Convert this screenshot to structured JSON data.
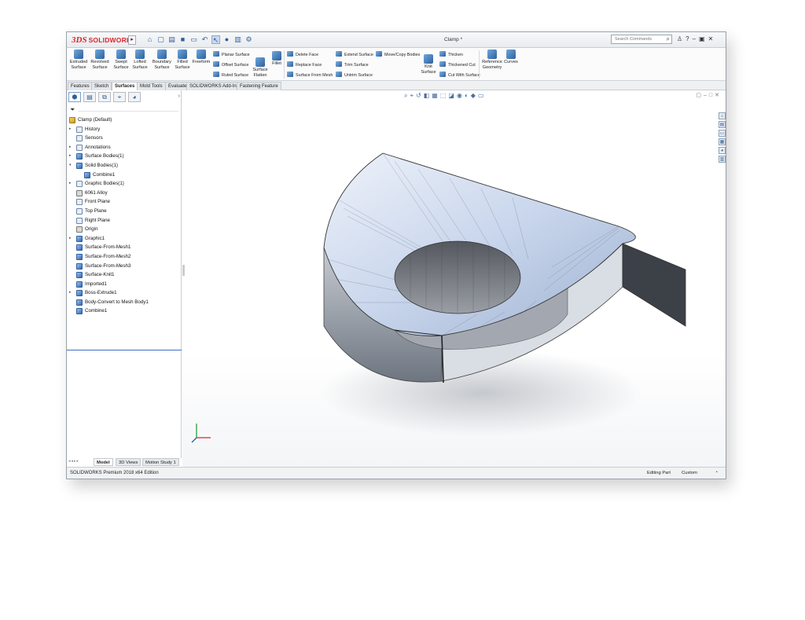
{
  "app": {
    "brand_mark": "3DS",
    "brand_name": "SOLIDWORKS",
    "doc_title": "Clamp *"
  },
  "search": {
    "placeholder": "Search Commands"
  },
  "ribbon": {
    "large_buttons": [
      {
        "label": "Extruded\nSurface",
        "icon": "extruded-surface-icon"
      },
      {
        "label": "Revolved\nSurface",
        "icon": "revolved-surface-icon"
      },
      {
        "label": "Swept\nSurface",
        "icon": "swept-surface-icon"
      },
      {
        "label": "Lofted\nSurface",
        "icon": "lofted-surface-icon"
      },
      {
        "label": "Boundary\nSurface",
        "icon": "boundary-surface-icon"
      },
      {
        "label": "Filled\nSurface",
        "icon": "filled-surface-icon"
      },
      {
        "label": "Freeform",
        "icon": "freeform-icon"
      }
    ],
    "col1": [
      "Planar Surface",
      "Offset Surface",
      "Ruled Surface"
    ],
    "surface_flatten": "Surface\nFlatten",
    "fillet": "Fillet",
    "col2": [
      "Delete Face",
      "Replace Face",
      "Surface From Mesh"
    ],
    "col3": [
      "Extend Surface",
      "Trim Surface",
      "Untrim Surface"
    ],
    "move_copy": "Move/Copy Bodies",
    "knit": "Knit\nSurface",
    "col4": [
      "Thicken",
      "Thickened Cut",
      "Cut With Surface"
    ],
    "reference_geometry": "Reference\nGeometry",
    "curves": "Curves"
  },
  "tabs": [
    "Features",
    "Sketch",
    "Surfaces",
    "Mold Tools",
    "Evaluate",
    "SOLIDWORKS Add-Ins",
    "Fastening Feature"
  ],
  "active_tab": "Surfaces",
  "tree": {
    "root": "Clamp  (Default)",
    "items": [
      {
        "label": "History",
        "expandable": true,
        "indent": 1,
        "icon": "history-icon"
      },
      {
        "label": "Sensors",
        "expandable": false,
        "indent": 1,
        "icon": "sensors-icon"
      },
      {
        "label": "Annotations",
        "expandable": true,
        "indent": 1,
        "icon": "annotations-icon"
      },
      {
        "label": "Surface Bodies(1)",
        "expandable": true,
        "indent": 1,
        "icon": "surface-bodies-icon"
      },
      {
        "label": "Solid Bodies(1)",
        "expandable": true,
        "expanded": true,
        "indent": 1,
        "icon": "solid-bodies-icon"
      },
      {
        "label": "Combine1",
        "expandable": false,
        "indent": 2,
        "icon": "combine-icon"
      },
      {
        "label": "Graphic Bodies(1)",
        "expandable": true,
        "indent": 1,
        "icon": "graphic-bodies-icon"
      },
      {
        "label": "6061 Alloy",
        "expandable": false,
        "indent": 1,
        "icon": "material-icon"
      },
      {
        "label": "Front Plane",
        "expandable": false,
        "indent": 1,
        "icon": "plane-icon"
      },
      {
        "label": "Top Plane",
        "expandable": false,
        "indent": 1,
        "icon": "plane-icon"
      },
      {
        "label": "Right Plane",
        "expandable": false,
        "indent": 1,
        "icon": "plane-icon"
      },
      {
        "label": "Origin",
        "expandable": false,
        "indent": 1,
        "icon": "origin-icon"
      },
      {
        "label": "Graphic1",
        "expandable": true,
        "indent": 1,
        "icon": "graphic-icon"
      },
      {
        "label": "Surface-From-Mesh1",
        "expandable": false,
        "indent": 1,
        "icon": "surface-from-mesh-icon"
      },
      {
        "label": "Surface-From-Mesh2",
        "expandable": false,
        "indent": 1,
        "icon": "surface-from-mesh-icon"
      },
      {
        "label": "Surface-From-Mesh3",
        "expandable": false,
        "indent": 1,
        "icon": "surface-from-mesh-icon"
      },
      {
        "label": "Surface-Knit1",
        "expandable": false,
        "indent": 1,
        "icon": "surface-knit-icon"
      },
      {
        "label": "Imported1",
        "expandable": false,
        "indent": 1,
        "icon": "imported-icon"
      },
      {
        "label": "Boss-Extrude1",
        "expandable": true,
        "indent": 1,
        "icon": "boss-extrude-icon"
      },
      {
        "label": "Body-Convert to Mesh Body1",
        "expandable": false,
        "indent": 1,
        "icon": "convert-mesh-icon"
      },
      {
        "label": "Combine1",
        "expandable": false,
        "indent": 1,
        "icon": "combine-icon"
      }
    ]
  },
  "bottom_tabs": [
    "Model",
    "3D Views",
    "Motion Study 1"
  ],
  "status": {
    "edition": "SOLIDWORKS Premium 2018 x64 Edition",
    "mode": "Editing Part",
    "units": "Custom"
  },
  "colors": {
    "brand": "#d9262c",
    "accent": "#2f5f9c",
    "selection_line": "#3a6dc3"
  }
}
